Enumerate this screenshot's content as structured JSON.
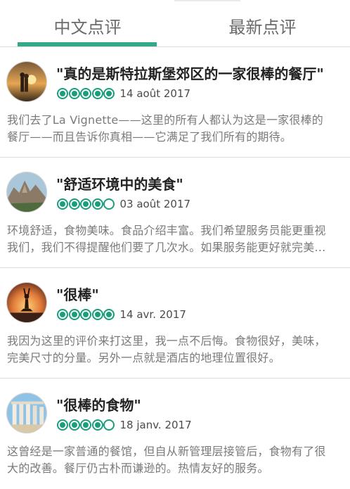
{
  "tabs": [
    {
      "label": "中文点评",
      "active": true
    },
    {
      "label": "最新点评",
      "active": false
    }
  ],
  "accent_color": "#34a98a",
  "bubble_color": "#1a9e7c",
  "reviews": [
    {
      "title": "\"真的是斯特拉斯堡郊区的一家很棒的餐厅\"",
      "rating": 5,
      "date": "14 août 2017",
      "avatar_icon": "couple-sunset-photo",
      "excerpt": "我们去了La Vignette——这里的所有人都认为这是一家很棒的餐厅——而且告诉你真相——它满足了我们所有的期待。"
    },
    {
      "title": "\"舒适环境中的美食\"",
      "rating": 4,
      "date": "03 août 2017",
      "avatar_icon": "rock-landscape-photo",
      "excerpt": "环境舒适，食物美味。食品介绍丰富。我们希望服务员能更重视我们，我们不得提醒他们要了几次水。如果服务能更好就完美了。"
    },
    {
      "title": "\"很棒\"",
      "rating": 5,
      "date": "14 avr. 2017",
      "avatar_icon": "yoga-sunset-photo",
      "excerpt": "我因为这里的评价来打这里，我一点不后悔。食物很好，美味，完美尺寸的分量。另外一点就是酒店的地理位置很好。"
    },
    {
      "title": "\"很棒的食物\"",
      "rating": 4,
      "date": "18 janv. 2017",
      "avatar_icon": "columns-ruins-photo",
      "excerpt": "这曾经是一家普通的餐馆，但自从新管理层接管后，食物有了很大的改善。餐厅仍古朴而谦逊的。热情友好的服务。"
    }
  ]
}
